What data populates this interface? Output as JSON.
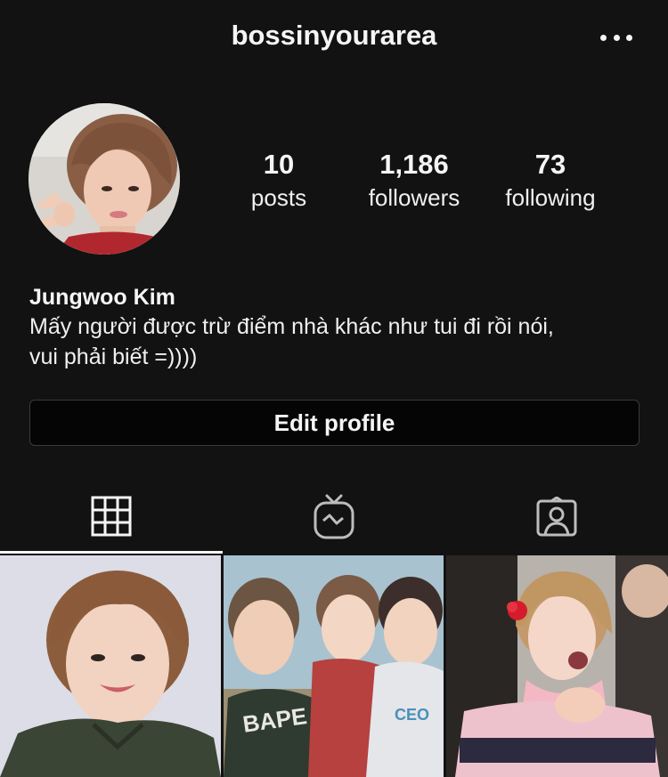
{
  "header": {
    "username": "bossinyourarea",
    "more_icon": "more-horizontal-icon"
  },
  "profile": {
    "avatar_alt": "profile photo",
    "stats": [
      {
        "value": "10",
        "label": "posts"
      },
      {
        "value": "1,186",
        "label": "followers"
      },
      {
        "value": "73",
        "label": "following"
      }
    ],
    "name": "Jungwoo Kim",
    "bio_line1": "Mấy người được trừ điểm nhà khác như tui đi rồi nói,",
    "bio_line2": "vui phải biết =))))",
    "edit_label": "Edit profile"
  },
  "tabs": [
    {
      "icon": "grid-icon",
      "active": true
    },
    {
      "icon": "igtv-icon",
      "active": false
    },
    {
      "icon": "tagged-icon",
      "active": false
    }
  ],
  "colors": {
    "background": "#121212",
    "text": "#f5f5f5",
    "button_border": "#3a3a3a"
  }
}
